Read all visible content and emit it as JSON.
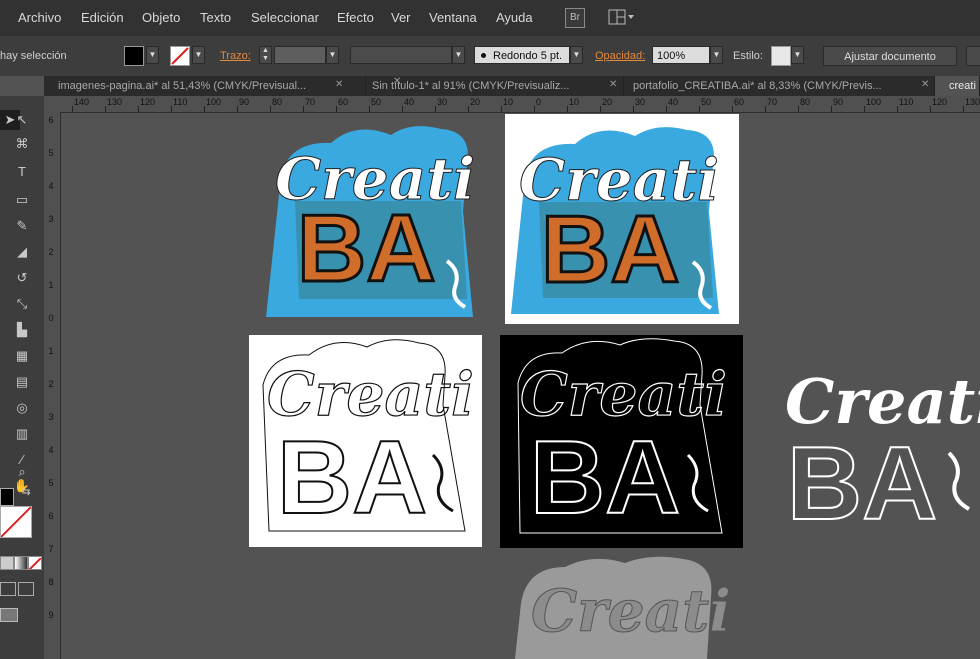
{
  "menu": {
    "items": [
      "Archivo",
      "Edición",
      "Objeto",
      "Texto",
      "Seleccionar",
      "Efecto",
      "Ver",
      "Ventana",
      "Ayuda"
    ],
    "bridge_icon": "Br",
    "workspace_icon": "layout-grid-icon"
  },
  "control_bar": {
    "selection_status": "hay selección",
    "stroke_label": "Trazo:",
    "brush_label": "Redondo 5 pt.",
    "opacity_label": "Opacidad:",
    "opacity_value": "100%",
    "style_label": "Estilo:",
    "fit_document_button": "Ajustar documento"
  },
  "tabs": [
    {
      "label": "imagenes-pagina.ai* al 51,43% (CMYK/Previsual...",
      "active": false
    },
    {
      "label": "Sin título-1* al 91% (CMYK/Previsualiz...",
      "active": false
    },
    {
      "label": "portafolio_CREATIBA.ai* al 8,33% (CMYK/Previs...",
      "active": false
    },
    {
      "label": "creati",
      "active": true
    }
  ],
  "ruler": {
    "top_ticks": [
      "140",
      "130",
      "120",
      "110",
      "100",
      "90",
      "80",
      "70",
      "60",
      "50",
      "40",
      "30",
      "20",
      "10",
      "0",
      "10",
      "20",
      "30",
      "40",
      "50",
      "60",
      "70",
      "80",
      "90",
      "100",
      "110",
      "120",
      "130"
    ],
    "left_ticks": [
      "6",
      "5",
      "4",
      "3",
      "2",
      "1",
      "0",
      "1",
      "2",
      "3",
      "4",
      "5",
      "6",
      "7",
      "8",
      "9"
    ]
  },
  "artboards": {
    "logo_text_top": "Creati",
    "logo_text_bottom": "BA",
    "colors": {
      "sky_blue": "#3aa9df",
      "white": "#ffffff",
      "black": "#000000",
      "grey": "#8c8c8c"
    }
  }
}
